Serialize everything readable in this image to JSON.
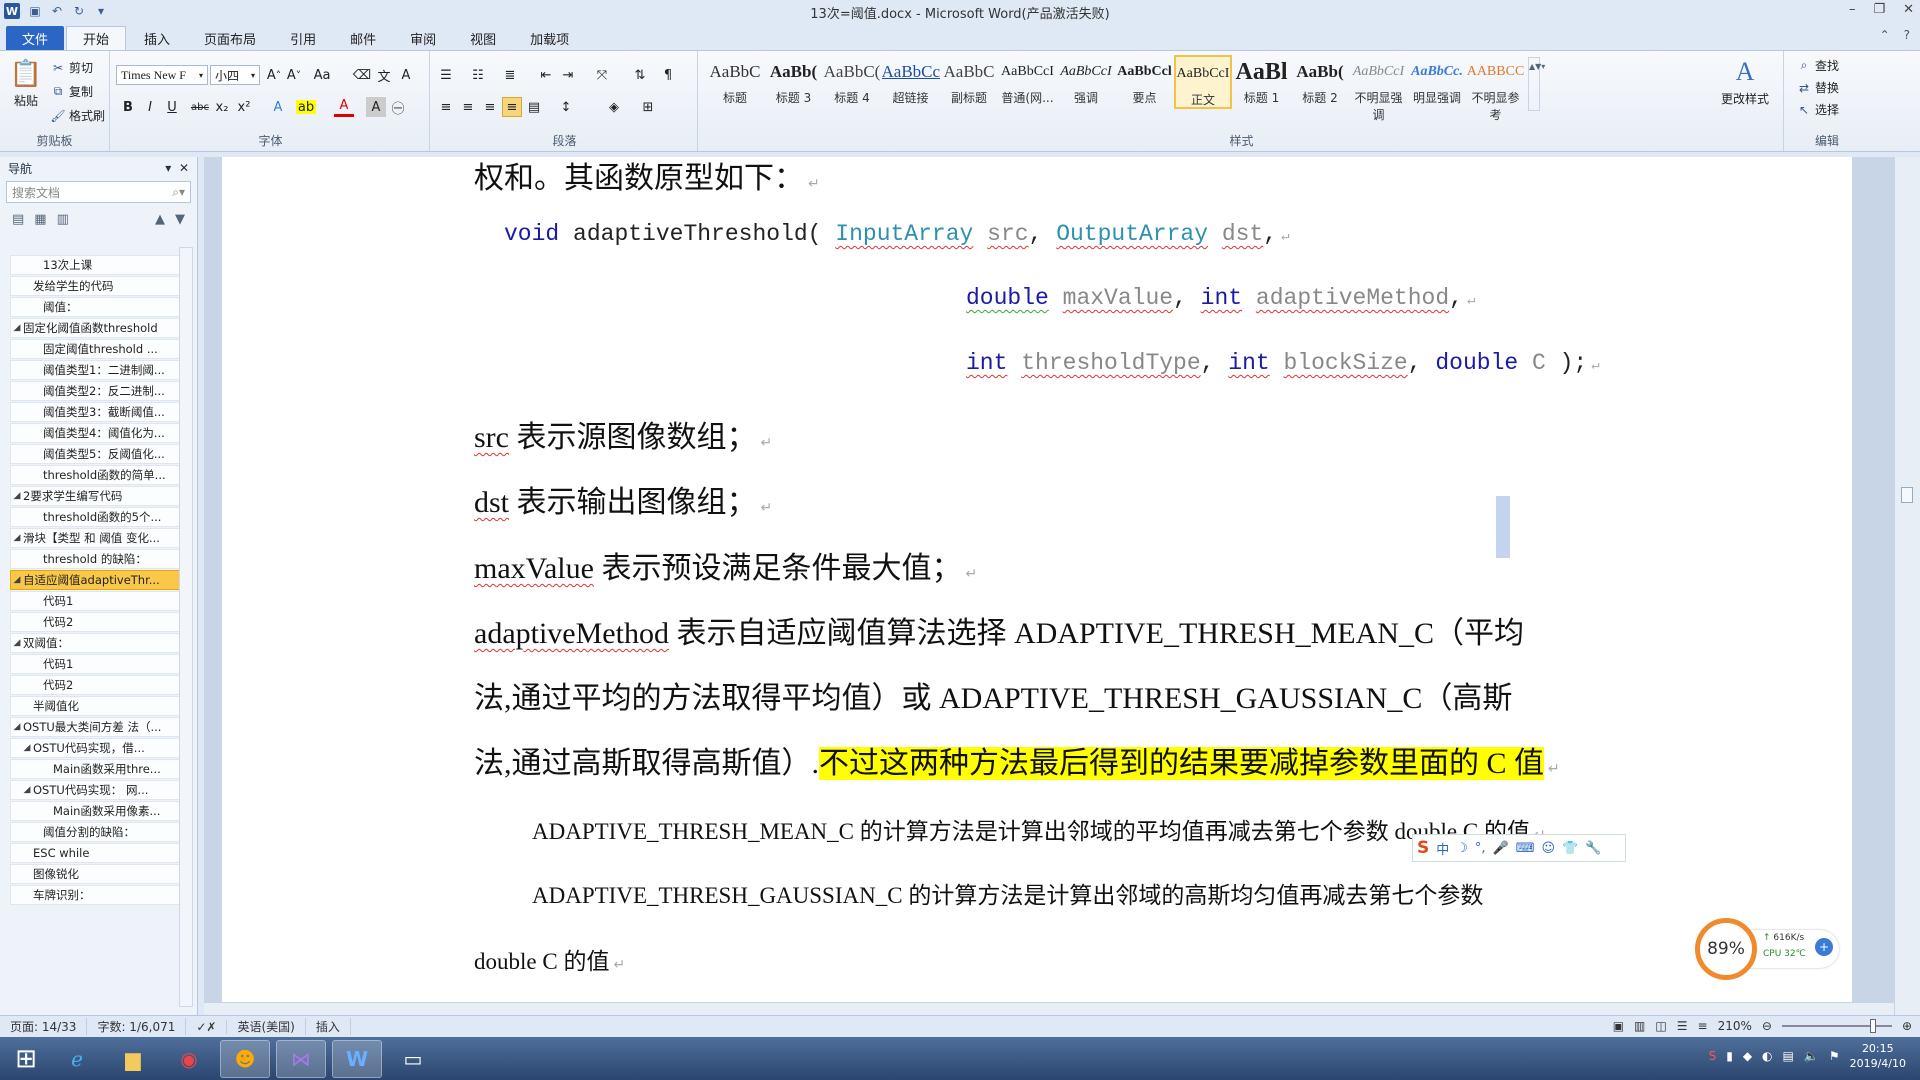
{
  "window": {
    "title": "13次=阈值.docx - Microsoft Word(产品激活失败)"
  },
  "tabs": [
    "文件",
    "开始",
    "插入",
    "页面布局",
    "引用",
    "邮件",
    "审阅",
    "视图",
    "加载项"
  ],
  "ribbon": {
    "clipboard": {
      "paste": "粘贴",
      "cut": "剪切",
      "copy": "复制",
      "format_painter": "格式刷",
      "label": "剪贴板"
    },
    "font": {
      "name": "Times New F",
      "size": "小四",
      "label": "字体"
    },
    "paragraph": {
      "label": "段落"
    },
    "styles": {
      "label": "样式",
      "items": [
        {
          "preview": "AaBbC",
          "name": "标题"
        },
        {
          "preview": "AaBb(",
          "name": "标题 3"
        },
        {
          "preview": "AaBbC(",
          "name": "标题 4"
        },
        {
          "preview": "AaBbCcI",
          "name": "超链接"
        },
        {
          "preview": "AaBbC",
          "name": "副标题"
        },
        {
          "preview": "AaBbCcI",
          "name": "普通(网..."
        },
        {
          "preview": "AaBbCcI",
          "name": "强调"
        },
        {
          "preview": "AaBbCcl",
          "name": "要点"
        },
        {
          "preview": "AaBbCcI",
          "name": "正文"
        },
        {
          "preview": "AaBl",
          "name": "标题 1"
        },
        {
          "preview": "AaBb(",
          "name": "标题 2"
        },
        {
          "preview": "AaBbCcI",
          "name": "不明显强调"
        },
        {
          "preview": "AaBbCc.",
          "name": "明显强调"
        },
        {
          "preview": "AABBCC",
          "name": "不明显参考"
        }
      ],
      "change": "更改样式"
    },
    "editing": {
      "find": "查找",
      "replace": "替换",
      "select": "选择",
      "label": "编辑"
    }
  },
  "nav": {
    "title": "导航",
    "search_placeholder": "搜索文档",
    "items": [
      {
        "label": "13次上课",
        "indent": 2,
        "tri": ""
      },
      {
        "label": "发给学生的代码",
        "indent": 1,
        "tri": ""
      },
      {
        "label": "阈值：",
        "indent": 2,
        "tri": ""
      },
      {
        "label": "固定化阈值函数threshold",
        "indent": 0,
        "tri": "◢"
      },
      {
        "label": "固定阈值threshold ...",
        "indent": 2,
        "tri": ""
      },
      {
        "label": "阈值类型1：二进制阈...",
        "indent": 2,
        "tri": ""
      },
      {
        "label": "阈值类型2：反二进制...",
        "indent": 2,
        "tri": ""
      },
      {
        "label": "阈值类型3：截断阈值...",
        "indent": 2,
        "tri": ""
      },
      {
        "label": "阈值类型4：阈值化为...",
        "indent": 2,
        "tri": ""
      },
      {
        "label": "阈值类型5：反阈值化...",
        "indent": 2,
        "tri": ""
      },
      {
        "label": "threshold函数的简单...",
        "indent": 2,
        "tri": ""
      },
      {
        "label": "2要求学生编写代码",
        "indent": 0,
        "tri": "◢"
      },
      {
        "label": "threshold函数的5个...",
        "indent": 2,
        "tri": ""
      },
      {
        "label": "滑块【类型 和 阈值 变化...",
        "indent": 0,
        "tri": "◢"
      },
      {
        "label": "threshold 的缺陷：",
        "indent": 2,
        "tri": ""
      },
      {
        "label": "自适应阈值adaptiveThr...",
        "indent": 0,
        "tri": "◢",
        "selected": true
      },
      {
        "label": "代码1",
        "indent": 2,
        "tri": ""
      },
      {
        "label": "代码2",
        "indent": 2,
        "tri": ""
      },
      {
        "label": "双阈值：",
        "indent": 0,
        "tri": "◢"
      },
      {
        "label": "代码1",
        "indent": 2,
        "tri": ""
      },
      {
        "label": "代码2",
        "indent": 2,
        "tri": ""
      },
      {
        "label": "半阈值化",
        "indent": 1,
        "tri": ""
      },
      {
        "label": "OSTU最大类间方差 法（...",
        "indent": 0,
        "tri": "◢"
      },
      {
        "label": "OSTU代码实现，借...",
        "indent": 1,
        "tri": "◢"
      },
      {
        "label": "Main函数采用thre...",
        "indent": 3,
        "tri": ""
      },
      {
        "label": "OSTU代码实现： 网...",
        "indent": 1,
        "tri": "◢"
      },
      {
        "label": "Main函数采用像素...",
        "indent": 3,
        "tri": ""
      },
      {
        "label": "阈值分割的缺陷：",
        "indent": 2,
        "tri": ""
      },
      {
        "label": "ESC  while",
        "indent": 1,
        "tri": ""
      },
      {
        "label": "图像锐化",
        "indent": 1,
        "tri": ""
      },
      {
        "label": "车牌识别：",
        "indent": 1,
        "tri": ""
      }
    ]
  },
  "doc": {
    "l1": "权和。其函数原型如下：",
    "c1_void": "void",
    "c1_fn": "adaptiveThreshold(",
    "c1_t1": "InputArray",
    "c1_p1": "src",
    "c1_sep1": ",",
    "c1_t2": "OutputArray",
    "c1_p2": "dst",
    ",": ",",
    "c2_t1": "double",
    "c2_p1": "maxValue",
    "c2_t2": "int",
    "c2_p2": "adaptiveMethod",
    "c3_t1": "int",
    "c3_p1": "thresholdType",
    "c3_t2": "int",
    "c3_p2": "blockSize",
    "c3_t3": "double",
    "c3_p3": "C",
    "c3_end": ");",
    "src_k": "src",
    "src_t": "表示源图像数组；",
    "dst_k": "dst",
    "dst_t": "表示输出图像组；",
    "max_k": "maxValue",
    "max_t": "表示预设满足条件最大值；",
    "am_k": "adaptiveMethod",
    "am_t1": "表示自适应阈值算法选择 ADAPTIVE_THRESH_MEAN_C（平均",
    "am_t2": "法,通过平均的方法取得平均值）或 ADAPTIVE_THRESH_GAUSSIAN_C（高斯",
    "am_t3a": "法,通过高斯取得高斯值）.",
    "am_t3b": "不过这两种方法最后得到的结果要减掉参数里面的 C 值",
    "mean_line": "ADAPTIVE_THRESH_MEAN_C 的计算方法是计算出邻域的平均值再减去第七个参数 double C 的值",
    "gauss_line": "ADAPTIVE_THRESH_GAUSSIAN_C  的计算方法是计算出邻域的高斯均匀值再减去第七个参数",
    "gauss_line2": "double C 的值"
  },
  "ime": {
    "lang": "中"
  },
  "cpu": {
    "percent": "89%",
    "net": "616K/s",
    "temp": "CPU 32℃"
  },
  "status": {
    "page": "页面: 14/33",
    "words": "字数: 1/6,071",
    "lang": "英语(美国)",
    "mode": "插入",
    "zoom": "210%"
  },
  "clock": {
    "time": "20:15",
    "date": "2019/4/10"
  }
}
